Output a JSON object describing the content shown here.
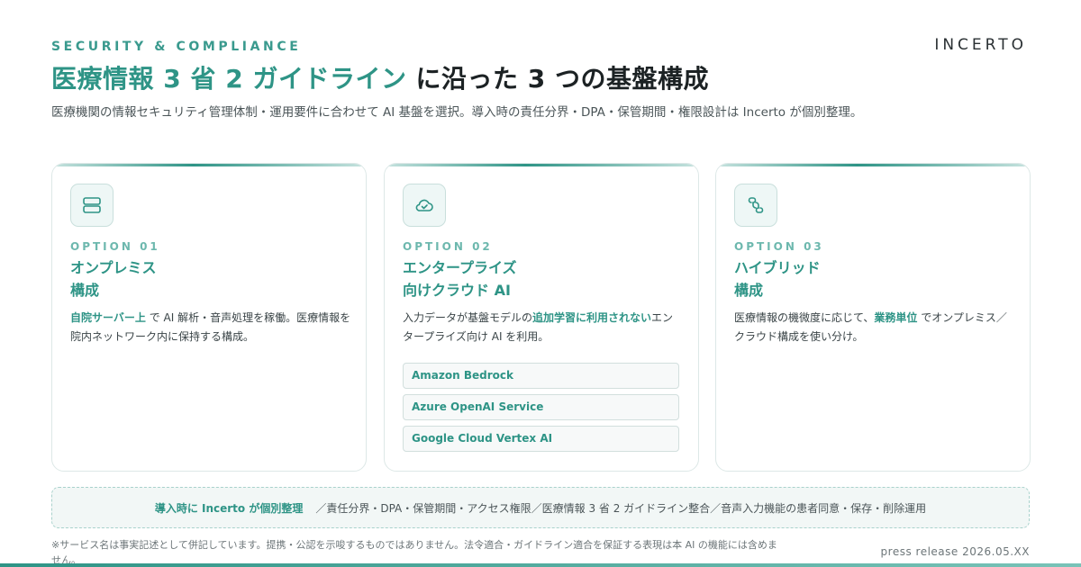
{
  "header": {
    "eyebrow": "SECURITY & COMPLIANCE",
    "logo_text": "INCERTO",
    "title_highlight": "医療情報 3 省 2 ガイドライン",
    "title_rest": "に沿った 3 つの基盤構成",
    "lead": "医療機関の情報セキュリティ管理体制・運用要件に合わせて AI 基盤を選択。導入時の責任分界・DPA・保管期間・権限設計は Incerto が個別整理。"
  },
  "options": [
    {
      "label": "OPTION 01",
      "title_line1": "オンプレミス",
      "title_line2": "構成",
      "icon": "server-icon",
      "desc_hl": "自院サーバー上",
      "desc_rest": " で AI 解析・音声処理を稼働。医療情報を院内ネットワーク内に保持する構成。"
    },
    {
      "label": "OPTION 02",
      "title_line1": "エンタープライズ",
      "title_line2": "向けクラウド AI",
      "icon": "cloud-check-icon",
      "desc_pre": "入力データが基盤モデルの",
      "desc_hl": "追加学習に利用されない",
      "desc_rest": "エンタープライズ向け AI を利用。",
      "services": [
        "Amazon Bedrock",
        "Azure OpenAI Service",
        "Google Cloud Vertex AI"
      ]
    },
    {
      "label": "OPTION 03",
      "title_line1": "ハイブリッド",
      "title_line2": "構成",
      "icon": "hybrid-link-icon",
      "desc_pre": "医療情報の機微度に応じて、",
      "desc_hl": "業務単位",
      "desc_rest": " でオンプレミス／クラウド構成を使い分け。"
    }
  ],
  "banner": {
    "lead": "導入時に Incerto が個別整理",
    "items": "／責任分界・DPA・保管期間・アクセス権限／医療情報 3 省 2 ガイドライン整合／音声入力機能の患者同意・保存・削除運用"
  },
  "footer": {
    "note": "※サービス名は事実記述として併記しています。提携・公認を示唆するものではありません。法令適合・ガイドライン適合を保証する表現は本 AI の機能には含めません。",
    "press": "press release 2026.05.XX"
  },
  "colors": {
    "accent": "#2e9486",
    "accent_light": "#6db8ae",
    "text": "#1c2224"
  }
}
